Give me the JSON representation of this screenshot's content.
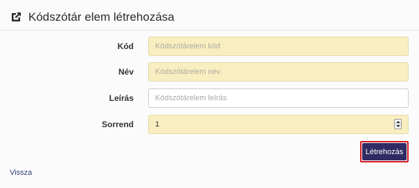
{
  "header": {
    "title": "Kódszótár elem létrehozása",
    "icon": "external-link-icon"
  },
  "form": {
    "fields": [
      {
        "label": "Kód",
        "placeholder": "Kódszótárelem kód",
        "value": "",
        "required": true
      },
      {
        "label": "Név",
        "placeholder": "Kódszótárelem név",
        "value": "",
        "required": true
      },
      {
        "label": "Leírás",
        "placeholder": "Kódszótárelem leírás",
        "value": "",
        "required": false
      },
      {
        "label": "Sorrend",
        "placeholder": "",
        "value": "1",
        "required": true
      }
    ],
    "submit_label": "Létrehozás"
  },
  "footer": {
    "back_label": "Vissza"
  },
  "colors": {
    "required_field_bg": "#f8eec0",
    "button_bg": "#2f2b63",
    "highlight_border": "#d4141e"
  }
}
